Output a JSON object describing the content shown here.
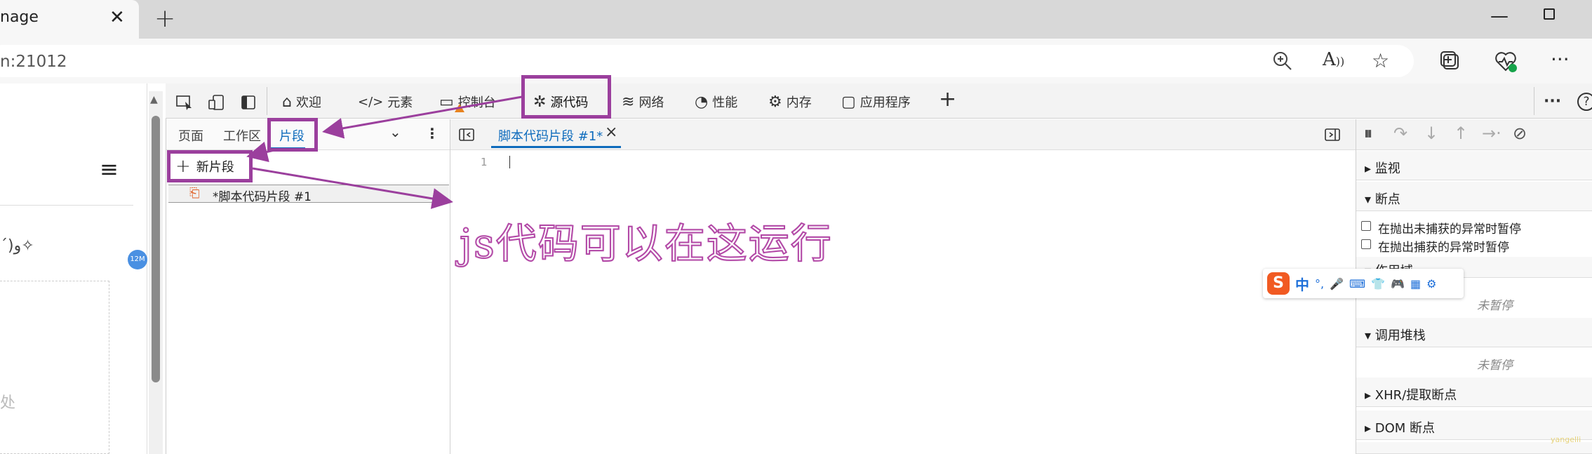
{
  "browser": {
    "tab_title": "nage",
    "close_glyph": "✕",
    "new_tab_glyph": "+",
    "minimize_glyph": "—",
    "url": "n:21012",
    "toolbar_icons": [
      "zoom-icon",
      "read-aloud-icon",
      "favorite-icon",
      "collections-icon",
      "health-icon",
      "more-icon"
    ]
  },
  "page": {
    "hamburger_glyph": "≡",
    "decoration_text": "ˊ)و✧",
    "badge": "12M",
    "hint": "处"
  },
  "devtools": {
    "tabs": [
      {
        "label": "欢迎",
        "icon": "⌂"
      },
      {
        "label": "元素",
        "icon": "</>"
      },
      {
        "label": "控制台",
        "icon": "▭"
      },
      {
        "label": "源代码",
        "icon": "✲"
      },
      {
        "label": "网络",
        "icon": "≋"
      },
      {
        "label": "性能",
        "icon": "◔"
      },
      {
        "label": "内存",
        "icon": "⚙"
      },
      {
        "label": "应用程序",
        "icon": "▢"
      }
    ],
    "add_tab_glyph": "+",
    "more_glyph": "···",
    "help_glyph": "?",
    "sources": {
      "nav_tabs": [
        "页面",
        "工作区",
        "片段"
      ],
      "new_snippet": "新片段",
      "snippet_name": "*脚本代码片段 #1",
      "editor_tab": "脚本代码片段 #1*",
      "line_number": "1"
    },
    "debugger": {
      "watch": "监视",
      "breakpoints": "断点",
      "pause_uncaught": "在抛出未捕获的异常时暂停",
      "pause_caught": "在抛出捕获的异常时暂停",
      "scope": "作用域",
      "not_paused_1": "未暂停",
      "call_stack": "调用堆栈",
      "not_paused_2": "未暂停",
      "xhr_breakpoints": "XHR/提取断点",
      "dom_breakpoints": "DOM 断点"
    }
  },
  "annotation": {
    "text": "js代码可以在这运行",
    "color": "#9b3f9d"
  },
  "ime": {
    "logo": "S",
    "lang": "中",
    "items": [
      "°,",
      "🎤",
      "⌨",
      "👕",
      "🎮",
      "▦",
      "⚙"
    ]
  },
  "watermark": "yangelli"
}
